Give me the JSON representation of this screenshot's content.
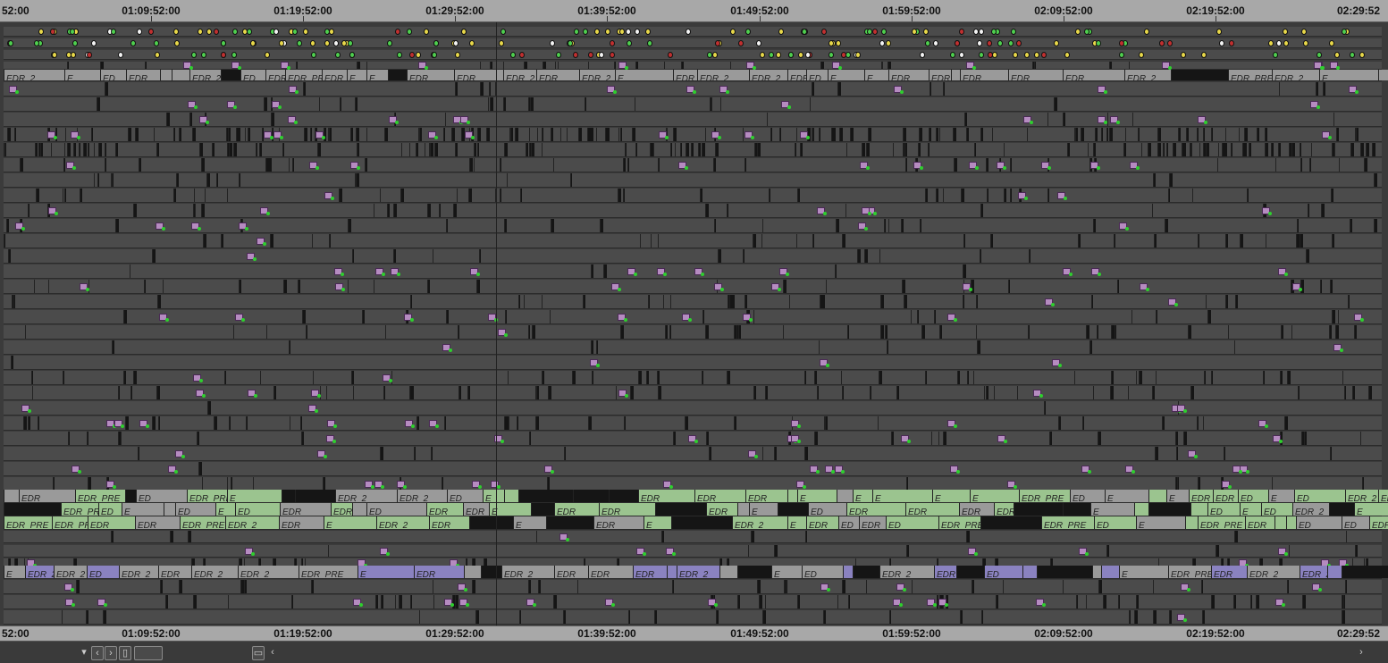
{
  "timeline": {
    "top_ruler": [
      "52:00",
      "01:09:52:00",
      "01:19:52:00",
      "01:29:52:00",
      "01:39:52:00",
      "01:49:52:00",
      "01:59:52:00",
      "02:09:52:00",
      "02:19:52:00",
      "02:29:52"
    ],
    "bottom_ruler": [
      "52:00",
      "01:09:52:00",
      "01:19:52:00",
      "01:29:52:00",
      "01:39:52:00",
      "01:49:52:00",
      "01:59:52:00",
      "02:09:52:00",
      "02:19:52:00",
      "02:29:52"
    ],
    "clip_labels": {
      "edr": "EDR",
      "edr_2": "EDR_2",
      "edr_pre": "EDR_PRE",
      "e": "E",
      "ed": "ED"
    }
  },
  "scroll_bar": {
    "dropdown_icon": "chevron-down-icon",
    "prev_icon": "chevron-left-icon",
    "next_icon": "chevron-right-icon",
    "zoom_icon": "zoom-fit-icon"
  },
  "colors": {
    "ruler": "#a8a8a8",
    "track_bg": "#4b4b4b",
    "edr_green": "#9bc48f",
    "edr_gray": "#9a9a9a",
    "edr_purple": "#8a82c0",
    "clip_marker": "#b58bc0",
    "marker_green": "#2ecf2e"
  }
}
